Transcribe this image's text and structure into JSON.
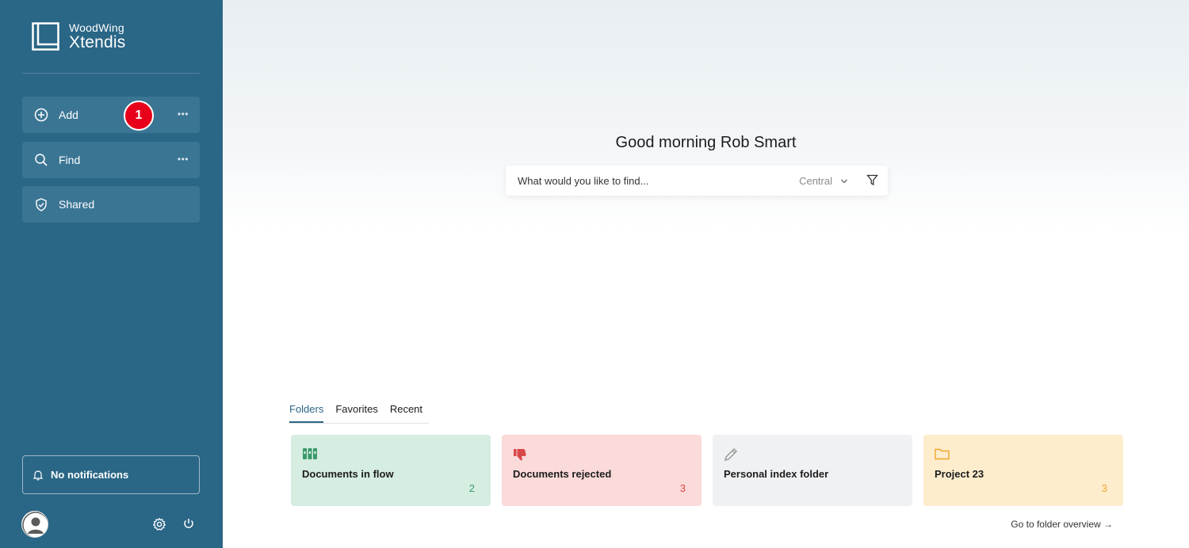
{
  "brand": {
    "top": "WoodWing",
    "bottom": "Xtendis"
  },
  "sidebar": {
    "items": [
      {
        "label": "Add",
        "icon": "plus-circle-icon",
        "more": "•••"
      },
      {
        "label": "Find",
        "icon": "search-icon",
        "more": "•••"
      },
      {
        "label": "Shared",
        "icon": "shield-icon"
      }
    ],
    "badge": "1",
    "notifications": "No notifications"
  },
  "main": {
    "greeting": "Good morning Rob Smart",
    "search": {
      "placeholder": "What would you like to find...",
      "scope": "Central"
    },
    "tabs": [
      "Folders",
      "Favorites",
      "Recent"
    ],
    "active_tab": "Folders",
    "cards": [
      {
        "title": "Documents in flow",
        "count": "2",
        "icon": "binders-icon",
        "color": "#3a9a6a"
      },
      {
        "title": "Documents rejected",
        "count": "3",
        "icon": "thumbs-down-icon",
        "color": "#d94848"
      },
      {
        "title": "Personal index folder",
        "count": "",
        "icon": "pencil-icon",
        "color": "#9a9a9a"
      },
      {
        "title": "Project 23",
        "count": "3",
        "icon": "folder-icon",
        "color": "#f0a52a"
      }
    ],
    "overview_link": "Go to folder overview →"
  },
  "colors": {
    "sidebar": "#2a6686",
    "nav_item": "#3b7594",
    "badge": "#e8001a",
    "accent": "#2a6686"
  }
}
